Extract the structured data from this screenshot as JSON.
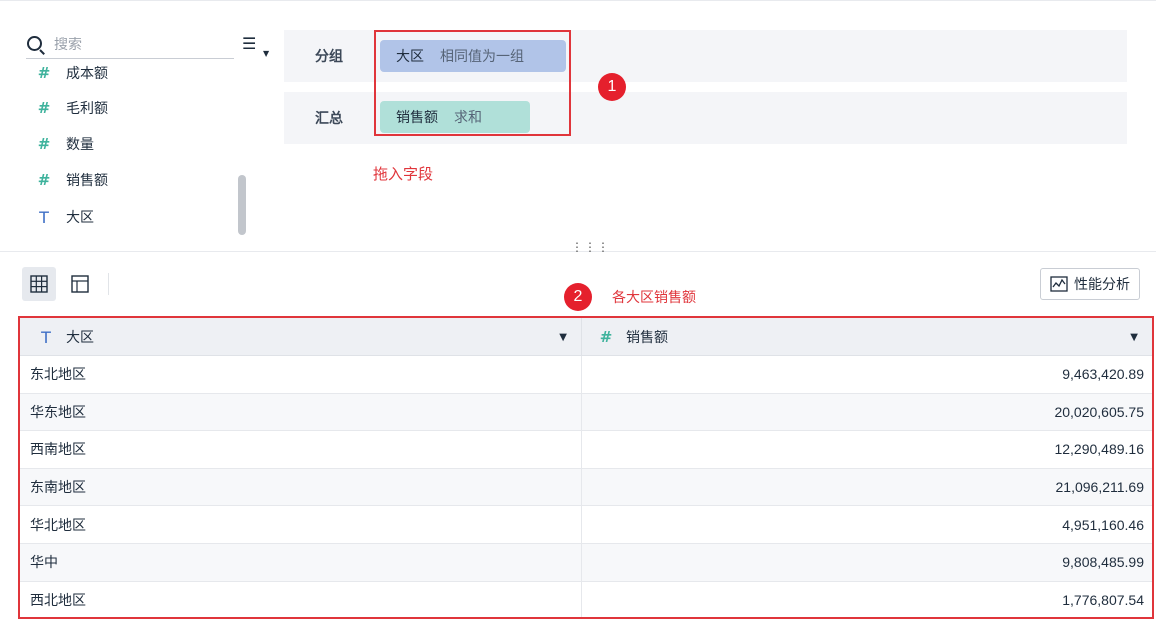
{
  "search": {
    "placeholder": "搜索"
  },
  "fields": [
    {
      "name": "成本额",
      "type": "number",
      "icon": "hash-icon"
    },
    {
      "name": "毛利额",
      "type": "number",
      "icon": "hash-icon"
    },
    {
      "name": "数量",
      "type": "number",
      "icon": "hash-icon"
    },
    {
      "name": "销售额",
      "type": "number",
      "icon": "hash-icon"
    },
    {
      "name": "大区",
      "type": "text",
      "icon": "text-type-icon"
    }
  ],
  "config": {
    "group_label": "分组",
    "summary_label": "汇总",
    "group_pill": {
      "field": "大区",
      "agg": "相同值为一组"
    },
    "summary_pill": {
      "field": "销售额",
      "agg": "求和"
    }
  },
  "annotations": {
    "badge1": "1",
    "badge2": "2",
    "drag_hint": "拖入字段",
    "table_hint": "各大区销售额"
  },
  "toolbar": {
    "perf_label": "性能分析"
  },
  "table": {
    "columns": [
      {
        "label": "大区",
        "icon": "text-type-icon"
      },
      {
        "label": "销售额",
        "icon": "hash-icon"
      }
    ],
    "rows": [
      [
        "东北地区",
        "9,463,420.89"
      ],
      [
        "华东地区",
        "20,020,605.75"
      ],
      [
        "西南地区",
        "12,290,489.16"
      ],
      [
        "东南地区",
        "21,096,211.69"
      ],
      [
        "华北地区",
        "4,951,160.46"
      ],
      [
        "华中",
        "9,808,485.99"
      ],
      [
        "西北地区",
        "1,776,807.54"
      ]
    ]
  },
  "colors": {
    "accent_red": "#e0353b",
    "group_pill": "#b1c4e8",
    "summary_pill": "#b0e0d9",
    "number_icon": "#3fb39d",
    "text_icon": "#3f6fc6"
  }
}
